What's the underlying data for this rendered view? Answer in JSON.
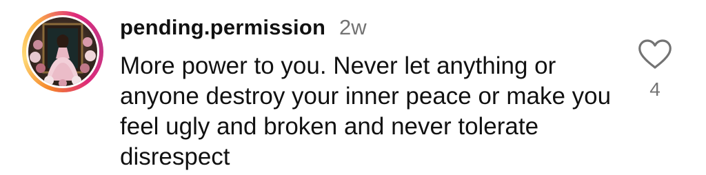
{
  "comment": {
    "username": "pending.permission",
    "time_ago": "2w",
    "text": "More power to you. Never let anything or anyone destroy your inner peace or make you feel ugly and broken and never tolerate disrespect",
    "like_count": "4",
    "like_icon": "heart-outline-icon"
  },
  "colors": {
    "text": "#111111",
    "secondary": "#737373",
    "story_ring_start": "#f58529",
    "story_ring_end": "#dd2a7b"
  }
}
